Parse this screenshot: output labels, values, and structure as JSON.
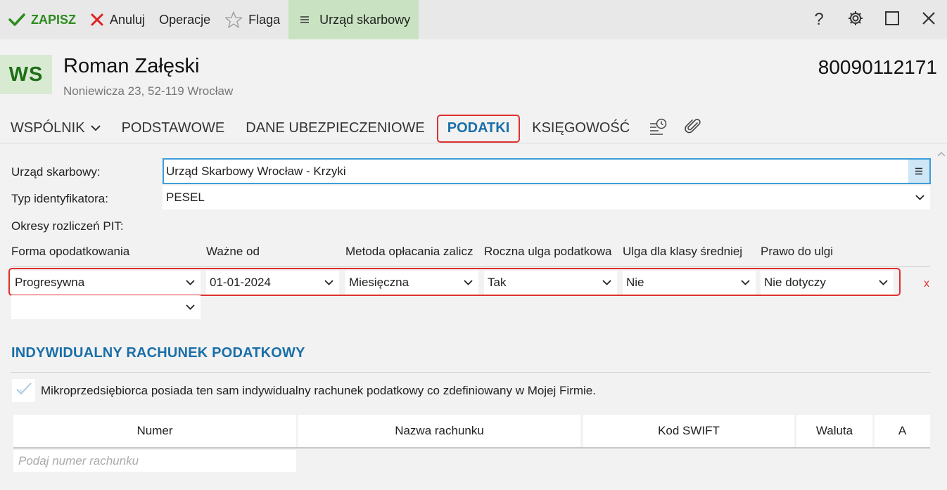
{
  "toolbar": {
    "save": "ZAPISZ",
    "cancel": "Anuluj",
    "operations": "Operacje",
    "flag": "Flaga",
    "active_item": "Urząd skarbowy",
    "help_icon": "question-icon",
    "settings_icon": "gear-icon",
    "maximize_icon": "maximize-icon",
    "close_icon": "close-icon"
  },
  "header": {
    "avatar": "WS",
    "name": "Roman Załęski",
    "address": "Noniewicza 23, 52-119 Wrocław",
    "id_number": "80090112171"
  },
  "tabs": [
    {
      "label": "WSPÓLNIK",
      "has_dropdown": true
    },
    {
      "label": "PODSTAWOWE"
    },
    {
      "label": "DANE UBEZPIECZENIOWE"
    },
    {
      "label": "PODATKI",
      "active": true
    },
    {
      "label": "KSIĘGOWOŚĆ"
    }
  ],
  "tab_icons": [
    "history-icon",
    "paperclip-icon"
  ],
  "form": {
    "tax_office_label": "Urząd skarbowy:",
    "tax_office_value": "Urząd Skarbowy Wrocław - Krzyki",
    "id_type_label": "Typ identyfikatora:",
    "id_type_value": "PESEL",
    "pit_periods_label": "Okresy rozliczeń PIT:"
  },
  "pit_table": {
    "columns": [
      "Forma opodatkowania",
      "Ważne od",
      "Metoda opłacania zalicz",
      "Roczna ulga podatkowa",
      "Ulga dla klasy średniej",
      "Prawo do ulgi"
    ],
    "row": {
      "forma": "Progresywna",
      "wazne_od": "01-01-2024",
      "metoda": "Miesięczna",
      "roczna_ulga": "Tak",
      "ulga_klasa": "Nie",
      "prawo": "Nie dotyczy"
    },
    "remove": "x"
  },
  "irp": {
    "title": "INDYWIDUALNY RACHUNEK PODATKOWY",
    "checkbox_checked": true,
    "checkbox_label": "Mikroprzedsiębiorca posiada ten sam indywidualny rachunek podatkowy co zdefiniowany w Mojej Firmie.",
    "columns": [
      "Numer",
      "Nazwa rachunku",
      "Kod SWIFT",
      "Waluta",
      "A"
    ],
    "input_placeholder": "Podaj numer rachunku"
  },
  "colors": {
    "accent_blue": "#1a6fa8",
    "save_green": "#2e8b1e",
    "highlight_red": "#e03030",
    "active_toolbar_bg": "#c9e3c2"
  }
}
